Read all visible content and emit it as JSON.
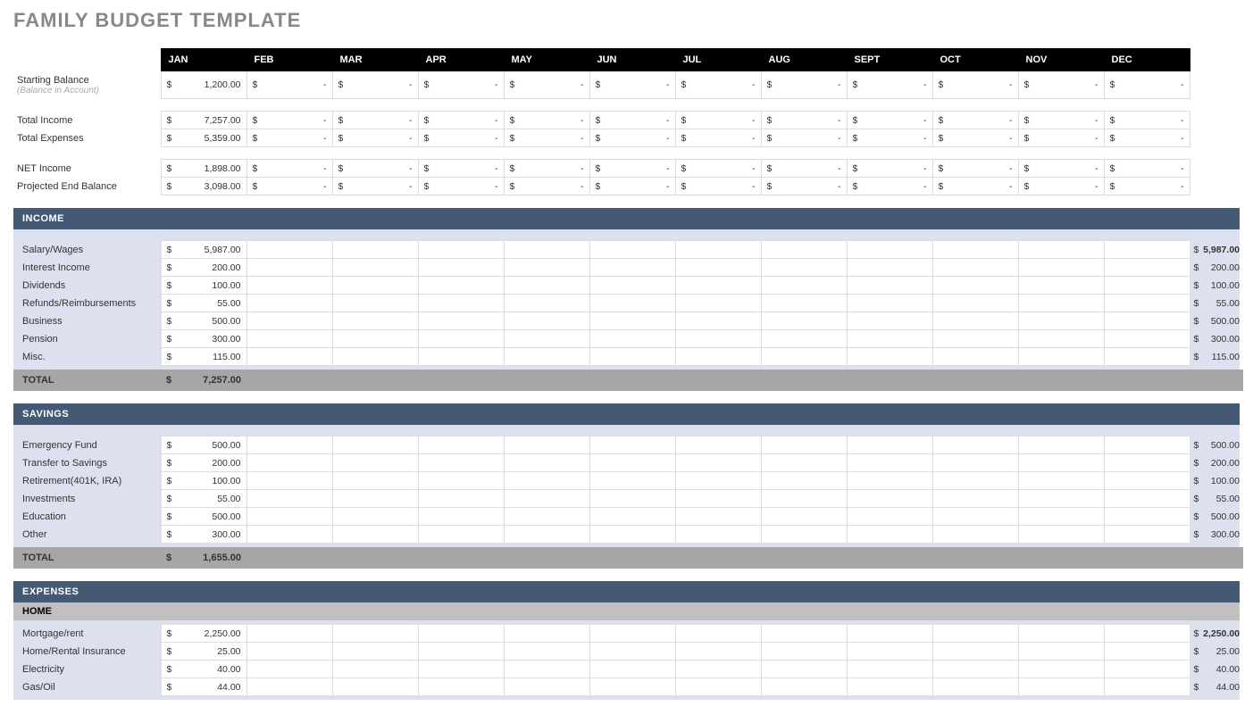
{
  "title": "FAMILY BUDGET TEMPLATE",
  "months": [
    "JAN",
    "FEB",
    "MAR",
    "APR",
    "MAY",
    "JUN",
    "JUL",
    "AUG",
    "SEPT",
    "OCT",
    "NOV",
    "DEC"
  ],
  "currency": "$",
  "dash": "-",
  "summary": {
    "rows": [
      {
        "label": "Starting Balance",
        "sublabel": "(Balance in Account)",
        "values": [
          "1,200.00",
          "-",
          "-",
          "-",
          "-",
          "-",
          "-",
          "-",
          "-",
          "-",
          "-",
          "-"
        ]
      },
      {
        "label": "Total Income",
        "values": [
          "7,257.00",
          "-",
          "-",
          "-",
          "-",
          "-",
          "-",
          "-",
          "-",
          "-",
          "-",
          "-"
        ]
      },
      {
        "label": "Total Expenses",
        "values": [
          "5,359.00",
          "-",
          "-",
          "-",
          "-",
          "-",
          "-",
          "-",
          "-",
          "-",
          "-",
          "-"
        ]
      },
      {
        "label": "NET Income",
        "values": [
          "1,898.00",
          "-",
          "-",
          "-",
          "-",
          "-",
          "-",
          "-",
          "-",
          "-",
          "-",
          "-"
        ]
      },
      {
        "label": "Projected End Balance",
        "values": [
          "3,098.00",
          "-",
          "-",
          "-",
          "-",
          "-",
          "-",
          "-",
          "-",
          "-",
          "-",
          "-"
        ]
      }
    ]
  },
  "income": {
    "title": "INCOME",
    "rows": [
      {
        "label": "Salary/Wages",
        "jan": "5,987.00",
        "total": "5,987.00"
      },
      {
        "label": "Interest Income",
        "jan": "200.00",
        "total": "200.00"
      },
      {
        "label": "Dividends",
        "jan": "100.00",
        "total": "100.00"
      },
      {
        "label": "Refunds/Reimbursements",
        "jan": "55.00",
        "total": "55.00"
      },
      {
        "label": "Business",
        "jan": "500.00",
        "total": "500.00"
      },
      {
        "label": "Pension",
        "jan": "300.00",
        "total": "300.00"
      },
      {
        "label": "Misc.",
        "jan": "115.00",
        "total": "115.00"
      }
    ],
    "total_label": "TOTAL",
    "total_jan": "7,257.00"
  },
  "savings": {
    "title": "SAVINGS",
    "rows": [
      {
        "label": "Emergency Fund",
        "jan": "500.00",
        "total": "500.00"
      },
      {
        "label": "Transfer to Savings",
        "jan": "200.00",
        "total": "200.00"
      },
      {
        "label": "Retirement(401K, IRA)",
        "jan": "100.00",
        "total": "100.00"
      },
      {
        "label": "Investments",
        "jan": "55.00",
        "total": "55.00"
      },
      {
        "label": "Education",
        "jan": "500.00",
        "total": "500.00"
      },
      {
        "label": "Other",
        "jan": "300.00",
        "total": "300.00"
      }
    ],
    "total_label": "TOTAL",
    "total_jan": "1,655.00"
  },
  "expenses": {
    "title": "EXPENSES",
    "home_title": "HOME",
    "rows": [
      {
        "label": "Mortgage/rent",
        "jan": "2,250.00",
        "total": "2,250.00"
      },
      {
        "label": "Home/Rental Insurance",
        "jan": "25.00",
        "total": "25.00"
      },
      {
        "label": "Electricity",
        "jan": "40.00",
        "total": "40.00"
      },
      {
        "label": "Gas/Oil",
        "jan": "44.00",
        "total": "44.00"
      }
    ]
  }
}
